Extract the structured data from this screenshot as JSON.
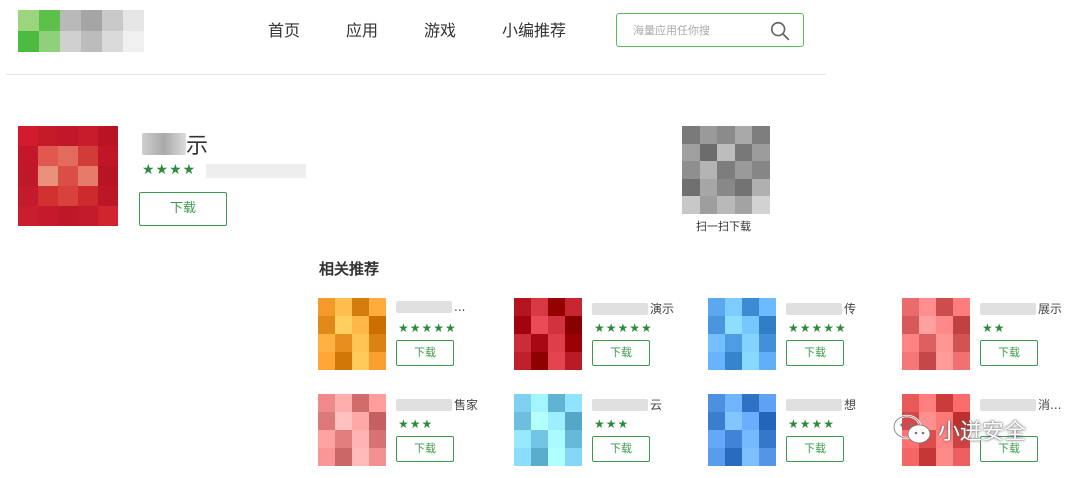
{
  "header": {
    "logo_colors": [
      "#8bd06f",
      "#39b54a",
      "#bdbdbd",
      "#9e9e9e",
      "#c7c7c7",
      "#e3e3e3"
    ],
    "nav": [
      "首页",
      "应用",
      "游戏",
      "小编推荐"
    ],
    "search": {
      "placeholder": "海量应用任你搜",
      "icon": "search-icon"
    }
  },
  "app": {
    "name_visible": "示",
    "rating_stars": "★★★★",
    "download_label": "下载",
    "icon_colors": [
      "#c0182a",
      "#d4232f",
      "#e05a4e",
      "#c41a2b",
      "#b81524"
    ]
  },
  "qr": {
    "label": "扫一扫下载"
  },
  "related": {
    "title": "相关推荐",
    "items": [
      {
        "name_visible": "...",
        "stars": "★★★★★",
        "button": "下载",
        "color": "#f39a2a"
      },
      {
        "name_visible": "演示",
        "stars": "★★★★★",
        "button": "下载",
        "color": "#b3141f"
      },
      {
        "name_visible": "传",
        "stars": "★★★★★",
        "button": "下载",
        "color": "#5aa8ef"
      },
      {
        "name_visible": "展示",
        "stars": "★★",
        "button": "下载",
        "color": "#e96b6b"
      },
      {
        "name_visible": "售家",
        "stars": "★★★",
        "button": "下载",
        "color": "#ef8a8a"
      },
      {
        "name_visible": "云",
        "stars": "★★★",
        "button": "下载",
        "color": "#7fd1f2"
      },
      {
        "name_visible": "想",
        "stars": "★★★★",
        "button": "下载",
        "color": "#4d8fe0"
      },
      {
        "name_visible": "消...",
        "stars": "",
        "button": "下载",
        "color": "#e85a5a"
      }
    ]
  },
  "watermark": {
    "text": "小迸安全"
  },
  "accent_color": "#3c9a4e"
}
